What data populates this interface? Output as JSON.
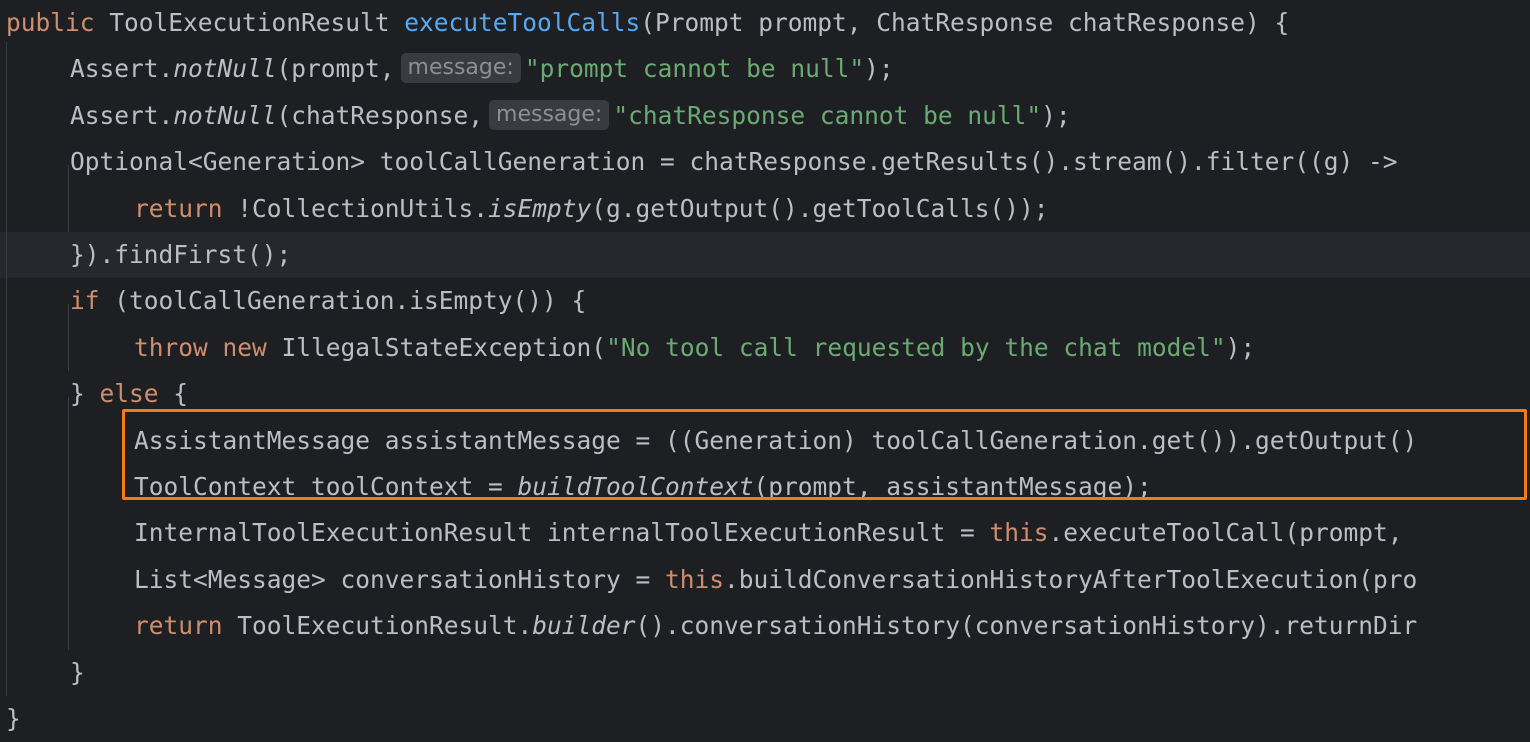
{
  "editor": {
    "theme_colors": {
      "background": "#1e1f22",
      "keyword": "#cf8e6d",
      "method_declaration": "#56a8f5",
      "string": "#6aab73",
      "default_text": "#bcbec4",
      "highlight_border": "#f57c14"
    },
    "lines": [
      {
        "tokens": [
          {
            "t": "public",
            "c": "kw"
          },
          {
            "t": " ToolExecutionResult ",
            "c": "df"
          },
          {
            "t": "executeToolCalls",
            "c": "fn"
          },
          {
            "t": "(Prompt prompt, ChatResponse chatResponse) {",
            "c": "df"
          }
        ]
      },
      {
        "tokens": [
          {
            "t": "Assert.",
            "c": "df"
          },
          {
            "t": "notNull",
            "c": "df it"
          },
          {
            "t": "(prompt,",
            "c": "df"
          },
          {
            "hint": "message:"
          },
          {
            "t": "\"prompt cannot be null\"",
            "c": "st"
          },
          {
            "t": ");",
            "c": "df"
          }
        ]
      },
      {
        "tokens": [
          {
            "t": "Assert.",
            "c": "df"
          },
          {
            "t": "notNull",
            "c": "df it"
          },
          {
            "t": "(chatResponse,",
            "c": "df"
          },
          {
            "hint": "message:"
          },
          {
            "t": "\"chatResponse cannot be null\"",
            "c": "st"
          },
          {
            "t": ");",
            "c": "df"
          }
        ]
      },
      {
        "tokens": [
          {
            "t": "Optional<Generation> toolCallGeneration = chatResponse.getResults().stream().filter((g) ->",
            "c": "df"
          }
        ]
      },
      {
        "tokens": [
          {
            "t": "return",
            "c": "kw"
          },
          {
            "t": " !CollectionUtils.",
            "c": "df"
          },
          {
            "t": "isEmpty",
            "c": "df it"
          },
          {
            "t": "(g.getOutput().getToolCalls());",
            "c": "df"
          }
        ]
      },
      {
        "tokens": [
          {
            "t": "}).findFirst();",
            "c": "df"
          }
        ]
      },
      {
        "tokens": [
          {
            "t": "if",
            "c": "kw"
          },
          {
            "t": " (toolCallGeneration.isEmpty()) {",
            "c": "df"
          }
        ]
      },
      {
        "tokens": [
          {
            "t": "throw",
            "c": "kw"
          },
          {
            "t": " ",
            "c": "df"
          },
          {
            "t": "new",
            "c": "kw"
          },
          {
            "t": " IllegalStateException(",
            "c": "df"
          },
          {
            "t": "\"No tool call requested by the chat model\"",
            "c": "st"
          },
          {
            "t": ");",
            "c": "df"
          }
        ]
      },
      {
        "tokens": [
          {
            "t": "} ",
            "c": "df"
          },
          {
            "t": "else",
            "c": "kw"
          },
          {
            "t": " {",
            "c": "df"
          }
        ]
      },
      {
        "tokens": [
          {
            "t": "AssistantMessage assistantMessage = ((Generation) toolCallGeneration.get()).getOutput()",
            "c": "df"
          }
        ]
      },
      {
        "tokens": [
          {
            "t": "ToolContext toolContext = ",
            "c": "df"
          },
          {
            "t": "buildToolContext",
            "c": "df it"
          },
          {
            "t": "(prompt, assistantMessage);",
            "c": "df"
          }
        ]
      },
      {
        "tokens": [
          {
            "t": "InternalToolExecutionResult internalToolExecutionResult = ",
            "c": "df"
          },
          {
            "t": "this",
            "c": "kw"
          },
          {
            "t": ".executeToolCall(prompt,",
            "c": "df"
          }
        ]
      },
      {
        "tokens": [
          {
            "t": "List<Message> conversationHistory = ",
            "c": "df"
          },
          {
            "t": "this",
            "c": "kw"
          },
          {
            "t": ".buildConversationHistoryAfterToolExecution(pro",
            "c": "df"
          }
        ]
      },
      {
        "tokens": [
          {
            "t": "return",
            "c": "kw"
          },
          {
            "t": " ToolExecutionResult.",
            "c": "df"
          },
          {
            "t": "builder",
            "c": "df it"
          },
          {
            "t": "().conversationHistory(conversationHistory).returnDir",
            "c": "df"
          }
        ]
      },
      {
        "tokens": [
          {
            "t": "}",
            "c": "df"
          }
        ]
      },
      {
        "tokens": [
          {
            "t": "}",
            "c": "df"
          }
        ]
      }
    ]
  }
}
